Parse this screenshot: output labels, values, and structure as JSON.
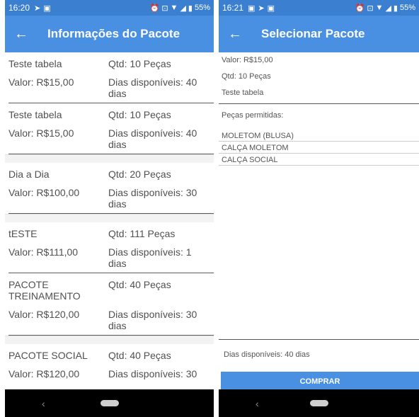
{
  "left": {
    "status": {
      "time": "16:20",
      "battery": "55%"
    },
    "title": "Informações do Pacote",
    "packages": [
      {
        "name": "Teste tabela",
        "qty": "Qtd: 10 Peças",
        "value": "Valor: R$15,00",
        "days": "Dias disponíveis: 40 dias"
      },
      {
        "name": "Teste tabela",
        "qty": "Qtd: 10 Peças",
        "value": "Valor: R$15,00",
        "days": "Dias disponíveis: 40 dias"
      },
      {
        "name": "Dia a Dia",
        "qty": "Qtd: 20 Peças",
        "value": "Valor: R$100,00",
        "days": "Dias disponíveis: 30 dias"
      },
      {
        "name": "tESTE",
        "qty": "Qtd: 111 Peças",
        "value": "Valor: R$111,00",
        "days": "Dias disponíveis: 1 dias"
      },
      {
        "name": "PACOTE TREINAMENTO",
        "qty": "Qtd: 40 Peças",
        "value": "Valor: R$120,00",
        "days": "Dias disponíveis: 30 dias"
      },
      {
        "name": "PACOTE SOCIAL",
        "qty": "Qtd: 40 Peças",
        "value": "Valor: R$120,00",
        "days": "Dias disponíveis: 30"
      }
    ]
  },
  "right": {
    "status": {
      "time": "16:21",
      "battery": "55%"
    },
    "title": "Selecionar Pacote",
    "value": "Valor: R$15,00",
    "qty": "Qtd: 10 Peças",
    "name": "Teste tabela",
    "allowed_label": "Peças permitidas:",
    "allowed_items": [
      "MOLETOM (BLUSA)",
      "CALÇA MOLETOM",
      "CALÇA SOCIAL"
    ],
    "days": "Dias disponíveis: 40 dias",
    "buy_label": "COMPRAR"
  },
  "icons": {
    "back": "arrow-left-icon",
    "nav_back": "chevron-left-icon",
    "nav_home": "home-pill-icon"
  },
  "colors": {
    "app_bar": "#4a90e2",
    "status_bar": "#3a7fd0"
  }
}
